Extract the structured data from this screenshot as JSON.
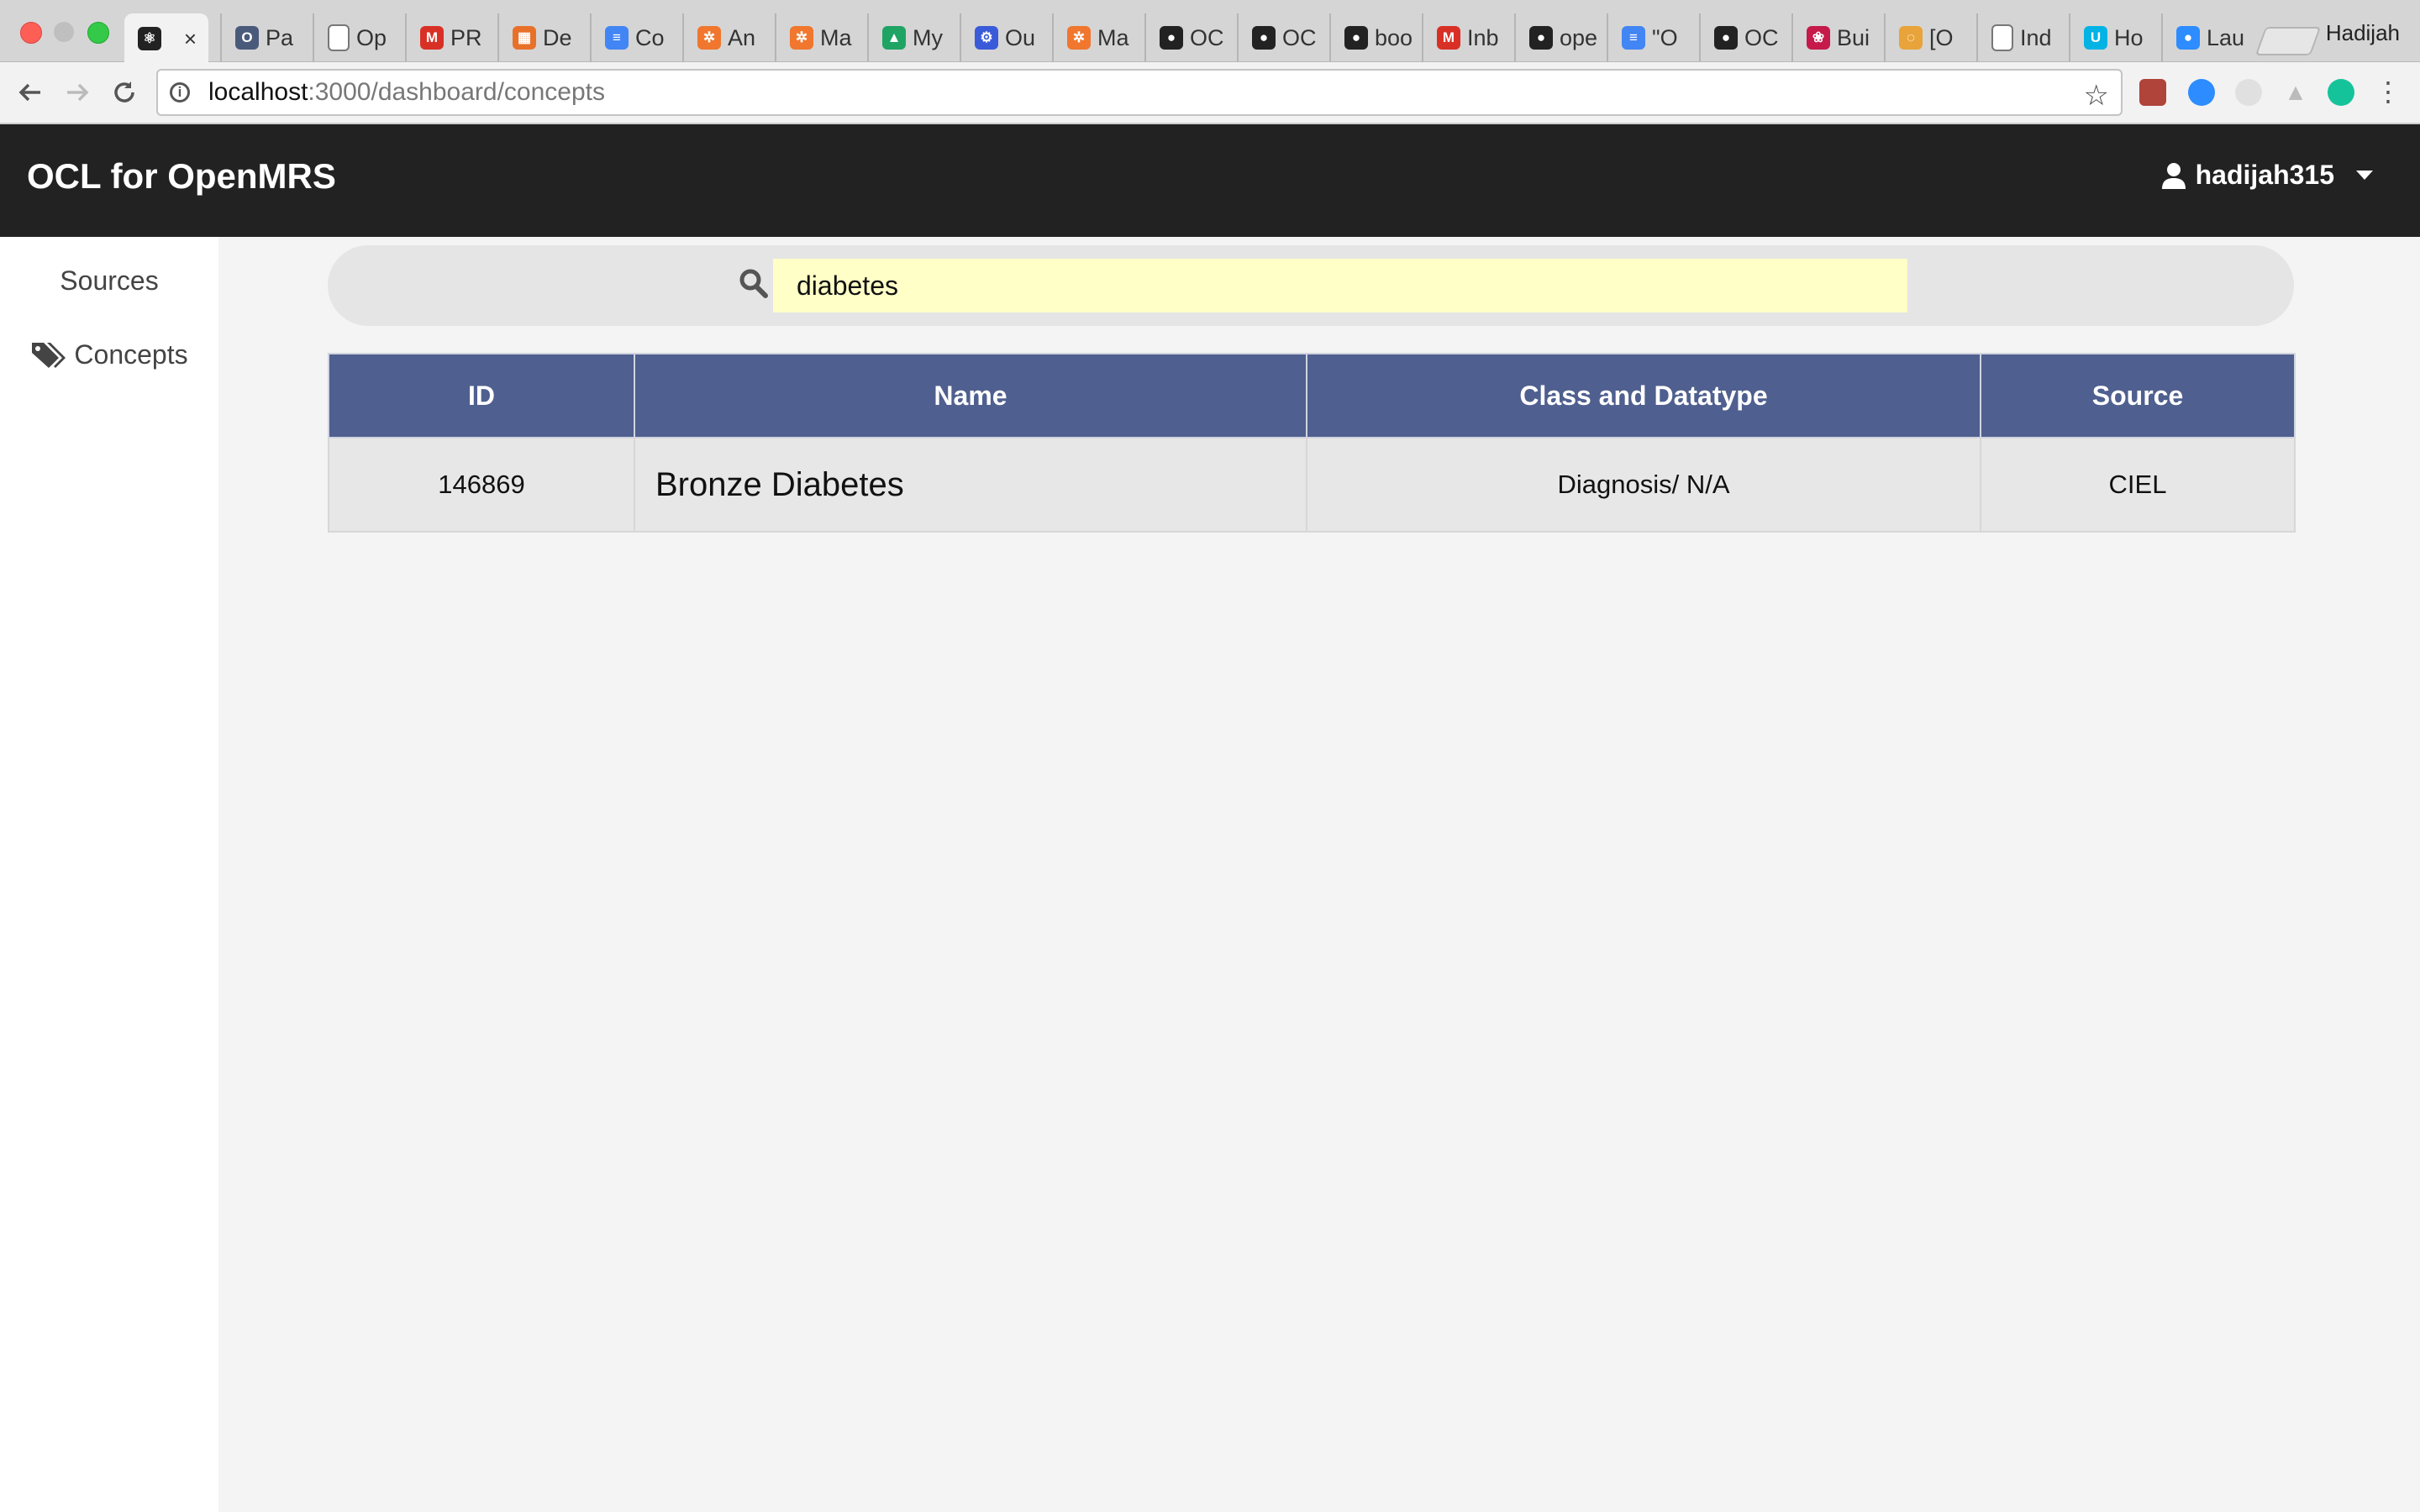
{
  "browser": {
    "tabs": [
      {
        "icon": "react-icon",
        "title": "",
        "active": true,
        "color": "#222222"
      },
      {
        "icon": "ocl-icon",
        "title": "Pa",
        "color": "#4a5a7a"
      },
      {
        "icon": "page-icon",
        "title": "Op",
        "color": "#ffffff"
      },
      {
        "icon": "gmail-icon",
        "title": "PR",
        "color": "#d93025"
      },
      {
        "icon": "grid-icon",
        "title": "De",
        "color": "#e8712a"
      },
      {
        "icon": "docs-icon",
        "title": "Co",
        "color": "#4285f4"
      },
      {
        "icon": "gear-orange-icon",
        "title": "An",
        "color": "#f0772d"
      },
      {
        "icon": "gear-orange-icon",
        "title": "Ma",
        "color": "#f0772d"
      },
      {
        "icon": "drive-icon",
        "title": "My",
        "color": "#1fa463"
      },
      {
        "icon": "app-blue-icon",
        "title": "Ou",
        "color": "#3a5bd9"
      },
      {
        "icon": "gear-orange-icon",
        "title": "Ma",
        "color": "#f0772d"
      },
      {
        "icon": "github-icon",
        "title": "OC",
        "color": "#222222"
      },
      {
        "icon": "github-icon",
        "title": "OC",
        "color": "#222222"
      },
      {
        "icon": "github-icon",
        "title": "boo",
        "color": "#222222"
      },
      {
        "icon": "gmail-icon",
        "title": "Inb",
        "color": "#d93025"
      },
      {
        "icon": "github-icon",
        "title": "ope",
        "color": "#222222"
      },
      {
        "icon": "docs-icon",
        "title": "\"O",
        "color": "#4285f4"
      },
      {
        "icon": "github-icon",
        "title": "OC",
        "color": "#222222"
      },
      {
        "icon": "raspberry-icon",
        "title": "Bui",
        "color": "#c51a4a"
      },
      {
        "icon": "circle-multi-icon",
        "title": "[O",
        "color": "#e8a33a"
      },
      {
        "icon": "page-icon",
        "title": "Ind",
        "color": "#ffffff"
      },
      {
        "icon": "udacity-icon",
        "title": "Ho",
        "color": "#02b3e4"
      },
      {
        "icon": "zoom-icon",
        "title": "Lau",
        "color": "#2d8cff"
      }
    ],
    "active_tab_close": "×",
    "profile_name": "Hadijah",
    "url_host": "localhost",
    "url_path": ":3000/dashboard/concepts"
  },
  "app": {
    "brand": "OCL for OpenMRS",
    "username": "hadijah315",
    "sidebar": [
      {
        "label": "Sources",
        "icon": ""
      },
      {
        "label": "Concepts",
        "icon": "tags-icon"
      }
    ],
    "search": {
      "value": "diabetes",
      "placeholder": ""
    },
    "table": {
      "columns": [
        "ID",
        "Name",
        "Class and Datatype",
        "Source"
      ],
      "rows": [
        [
          "146869",
          "Bronze Diabetes",
          "Diagnosis/ N/A",
          "CIEL"
        ]
      ]
    }
  },
  "colors": {
    "header_bg": "#222222",
    "table_header_bg": "#4f5f8f",
    "search_input_bg": "#ffffc7",
    "page_bg": "#f4f4f4"
  }
}
